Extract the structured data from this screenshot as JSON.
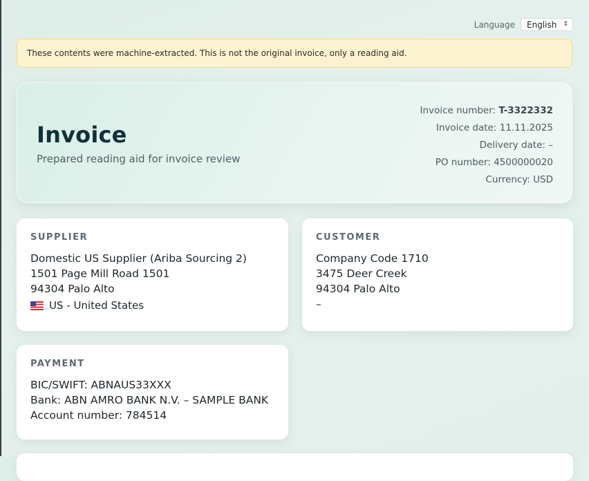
{
  "language": {
    "label": "Language",
    "selected": "English"
  },
  "notice": {
    "text": "These contents were machine-extracted. This is not the original invoice, only a reading aid."
  },
  "header": {
    "title": "Invoice",
    "subtitle": "Prepared reading aid for invoice review",
    "invoice_number_label": "Invoice number: ",
    "invoice_number": "T-3322332",
    "invoice_date": "Invoice date: 11.11.2025",
    "delivery_date": "Delivery date: –",
    "po_number": "PO number: 4500000020",
    "currency": "Currency: USD"
  },
  "supplier": {
    "heading": "SUPPLIER",
    "name": "Domestic US Supplier (Ariba Sourcing 2)",
    "street": "1501 Page Mill Road 1501",
    "city": "94304 Palo Alto",
    "country": "US - United States",
    "country_icon": "us-flag-icon"
  },
  "customer": {
    "heading": "CUSTOMER",
    "name": "Company Code 1710",
    "street": "3475 Deer Creek",
    "city": "94304 Palo Alto",
    "country": "–"
  },
  "payment": {
    "heading": "PAYMENT",
    "bic": "BIC/SWIFT: ABNAUS33XXX",
    "bank": "Bank: ABN AMRO BANK N.V. – SAMPLE BANK",
    "account": "Account number: 784514"
  },
  "colors": {
    "background": "#e3efeb",
    "notice_bg": "#fdf3d0",
    "notice_border": "#efd98a",
    "title": "#10303a"
  }
}
